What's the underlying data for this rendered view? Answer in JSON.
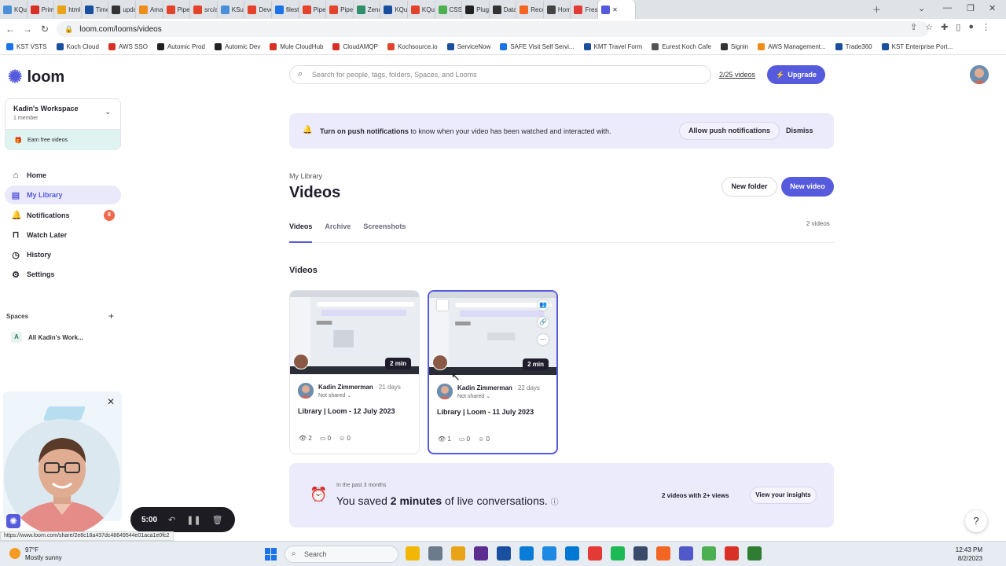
{
  "browser": {
    "tabs": [
      {
        "label": "KQue",
        "color": "#4a90d9"
      },
      {
        "label": "Prim",
        "color": "#d93025"
      },
      {
        "label": "html",
        "color": "#e8a317"
      },
      {
        "label": "Time",
        "color": "#1a4fa0"
      },
      {
        "label": "upda",
        "color": "#333333"
      },
      {
        "label": "Ama",
        "color": "#f08c1a"
      },
      {
        "label": "Pipel",
        "color": "#e2432a"
      },
      {
        "label": "src/a",
        "color": "#e2432a"
      },
      {
        "label": "KSuit",
        "color": "#4a90d9"
      },
      {
        "label": "Deve",
        "color": "#e2432a"
      },
      {
        "label": "filest",
        "color": "#1a73e8"
      },
      {
        "label": "Pipel",
        "color": "#e2432a"
      },
      {
        "label": "Pipel",
        "color": "#e2432a"
      },
      {
        "label": "Zend",
        "color": "#2f8f6a"
      },
      {
        "label": "KQue",
        "color": "#1a4fa0"
      },
      {
        "label": "KQue",
        "color": "#e2432a"
      },
      {
        "label": "CSS T",
        "color": "#4caf50"
      },
      {
        "label": "Plugi",
        "color": "#222222"
      },
      {
        "label": "Data",
        "color": "#333333"
      },
      {
        "label": "Reco",
        "color": "#f26522"
      },
      {
        "label": "Hom",
        "color": "#444444"
      },
      {
        "label": "Fresh",
        "color": "#e53935"
      }
    ],
    "url": "loom.com/looms/videos",
    "bookmarks": [
      {
        "label": "KST VSTS",
        "color": "#1a73e8"
      },
      {
        "label": "Koch Cloud",
        "color": "#1a4fa0"
      },
      {
        "label": "AWS SSO",
        "color": "#d93025"
      },
      {
        "label": "Automic Prod",
        "color": "#222222"
      },
      {
        "label": "Automic Dev",
        "color": "#222222"
      },
      {
        "label": "Mule CloudHub",
        "color": "#d93025"
      },
      {
        "label": "CloudAMQP",
        "color": "#d93025"
      },
      {
        "label": "Kochsource.io",
        "color": "#e2432a"
      },
      {
        "label": "ServiceNow",
        "color": "#1a4fa0"
      },
      {
        "label": "SAFE Visit Self Servi...",
        "color": "#1a73e8"
      },
      {
        "label": "KMT Travel Form",
        "color": "#1a4fa0"
      },
      {
        "label": "Eurest Koch Cafe",
        "color": "#555555"
      },
      {
        "label": "Signin",
        "color": "#333333"
      },
      {
        "label": "AWS Management...",
        "color": "#f08c1a"
      },
      {
        "label": "Trade360",
        "color": "#1a4fa0"
      },
      {
        "label": "KST Enterprise Port...",
        "color": "#1a4fa0"
      }
    ],
    "status_url": "https://www.loom.com/share/2e8c18a437dc48649544e01aca1e0fc2"
  },
  "sidebar": {
    "brand": "loom",
    "workspace_name": "Kadin's Workspace",
    "workspace_members": "1 member",
    "earn_label": "Earn free videos",
    "nav": [
      {
        "label": "Home",
        "icon": "home-icon",
        "glyph": "⌂"
      },
      {
        "label": "My Library",
        "icon": "library-icon",
        "glyph": "▤"
      },
      {
        "label": "Notifications",
        "icon": "bell-icon",
        "glyph": "🔔",
        "badge": "8"
      },
      {
        "label": "Watch Later",
        "icon": "bookmark-icon",
        "glyph": "⊓"
      },
      {
        "label": "History",
        "icon": "clock-icon",
        "glyph": "◷"
      },
      {
        "label": "Settings",
        "icon": "gear-icon",
        "glyph": "⚙"
      }
    ],
    "spaces_heading": "Spaces",
    "space_item": "All Kadin's Work...",
    "space_letter": "A"
  },
  "recorder": {
    "time": "5:00"
  },
  "header": {
    "search_placeholder": "Search for people, tags, folders, Spaces, and Looms",
    "usage": "2/25 videos",
    "upgrade": "Upgrade"
  },
  "banner": {
    "bold": "Turn on push notifications",
    "rest": " to know when your video has been watched and interacted with.",
    "allow": "Allow push notifications",
    "dismiss": "Dismiss"
  },
  "page": {
    "breadcrumb": "My Library",
    "title": "Videos",
    "new_folder": "New folder",
    "new_video": "New video",
    "tabs": [
      "Videos",
      "Archive",
      "Screenshots"
    ],
    "video_count": "2 videos",
    "section_heading": "Videos"
  },
  "videos": [
    {
      "author": "Kadin Zimmerman",
      "age": " · 21 days",
      "share": "Not shared",
      "title": "Library | Loom - 12 July 2023",
      "duration": "2 min",
      "views": "2",
      "comments": "0",
      "reactions": "0"
    },
    {
      "author": "Kadin Zimmerman",
      "age": " · 22 days",
      "share": "Not shared",
      "title": "Library | Loom - 11 July 2023",
      "duration": "2 min",
      "views": "1",
      "comments": "0",
      "reactions": "0"
    }
  ],
  "insights": {
    "sub": "In the past 3 months",
    "line_pre": "You saved ",
    "line_bold": "2 minutes",
    "line_post": " of live conversations.",
    "views": "2 videos with 2+ views",
    "button": "View your insights"
  },
  "taskbar": {
    "temp": "97°F",
    "weather": "Mostly sunny",
    "search": "Search",
    "time": "12:43 PM",
    "date": "8/2/2023",
    "apps": [
      "#f2b705",
      "#6b7b8c",
      "#e8a317",
      "#5c2d91",
      "#1a4fa0",
      "#0a7cd7",
      "#1e88e5",
      "#0078d4",
      "#e53935",
      "#1db954",
      "#3a4a6b",
      "#f26522",
      "#5059c9",
      "#4caf50",
      "#d93025",
      "#2e7d32"
    ]
  }
}
